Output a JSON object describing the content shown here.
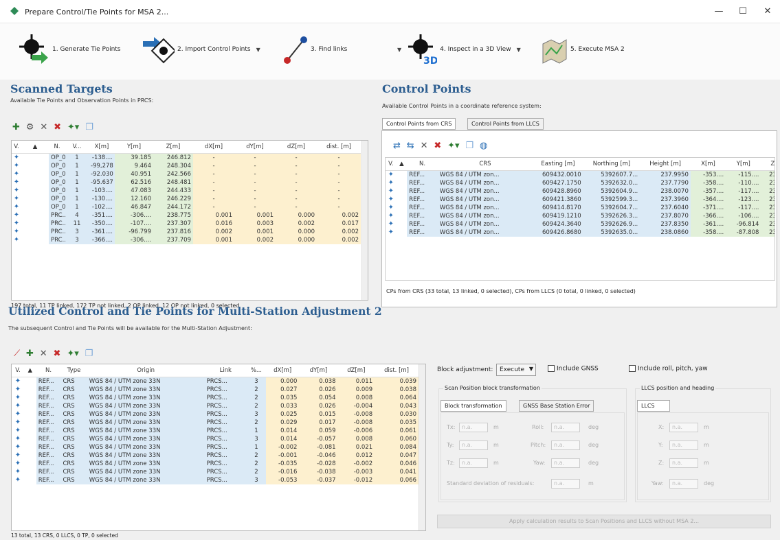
{
  "window": {
    "title": "Prepare Control/Tie Points for MSA 2..."
  },
  "toolbar": {
    "generate": "1. Generate Tie Points",
    "import": "2. Import Control Points",
    "find": "3. Find links",
    "inspect": "4. Inspect in a 3D View",
    "execute": "5. Execute MSA 2"
  },
  "scanned": {
    "title": "Scanned Targets",
    "subtitle": "Available Tie Points and Observation Points in PRCS:",
    "headers": [
      "V.",
      "▲",
      "N.",
      "V...",
      "X[m]",
      "Y[m]",
      "Z[m]",
      "dX[m]",
      "dY[m]",
      "dZ[m]",
      "dist. [m]"
    ],
    "rows": [
      [
        "",
        "OP_01",
        "1",
        "-138....",
        "39.185",
        "246.812",
        "-",
        "-",
        "-",
        "-"
      ],
      [
        "",
        "OP_02",
        "1",
        "-99,278",
        "9.464",
        "248.304",
        "-",
        "-",
        "-",
        "-"
      ],
      [
        "",
        "OP_03",
        "1",
        "-92.030",
        "40.951",
        "242.566",
        "-",
        "-",
        "-",
        "-"
      ],
      [
        "",
        "OP_04",
        "1",
        "-95.637",
        "62.516",
        "248.481",
        "-",
        "-",
        "-",
        "-"
      ],
      [
        "",
        "OP_05",
        "1",
        "-103....",
        "47.083",
        "244.433",
        "-",
        "-",
        "-",
        "-"
      ],
      [
        "",
        "OP_06",
        "1",
        "-130....",
        "12.160",
        "246.229",
        "-",
        "-",
        "-",
        "-"
      ],
      [
        "",
        "OP_07",
        "1",
        "-102....",
        "46.847",
        "244.172",
        "-",
        "-",
        "-",
        "-"
      ],
      [
        "",
        "PRC...",
        "4",
        "-351....",
        "-306....",
        "238.775",
        "0.001",
        "0.001",
        "0.000",
        "0.002"
      ],
      [
        "",
        "PRC...",
        "11",
        "-350....",
        "-107....",
        "237.307",
        "0.016",
        "0.003",
        "0.002",
        "0.017"
      ],
      [
        "",
        "PRC...",
        "3",
        "-361....",
        "-96.799",
        "237.816",
        "0.002",
        "0.001",
        "0.000",
        "0.002"
      ],
      [
        "",
        "PRC...",
        "3",
        "-366....",
        "-306....",
        "237.709",
        "0.001",
        "0.002",
        "0.000",
        "0.002"
      ]
    ],
    "status": "197 total, 11 TP linked, 172 TP not linked, 2 OP linked, 12 OP not linked, 0 selected"
  },
  "control": {
    "title": "Control Points",
    "subtitle": "Available Control Points in a coordinate reference system:",
    "tabs": [
      "Control Points from CRS",
      "Control Points from LLCS"
    ],
    "headers": [
      "V.",
      "▲",
      "N.",
      "CRS",
      "Easting [m]",
      "Northing [m]",
      "Height [m]",
      "X[m]",
      "Y[m]",
      "Z"
    ],
    "rows": [
      [
        "REF...",
        "WGS 84 / UTM zon...",
        "609432.0010",
        "5392607.7...",
        "237.9950",
        "-353....",
        "-115....",
        "237."
      ],
      [
        "REF...",
        "WGS 84 / UTM zon...",
        "609427.1750",
        "5392632.0...",
        "237.7790",
        "-358....",
        "-110....",
        "237."
      ],
      [
        "REF...",
        "WGS 84 / UTM zon...",
        "609428.8960",
        "5392604.9...",
        "238.0070",
        "-357....",
        "-117....",
        "237."
      ],
      [
        "REF...",
        "WGS 84 / UTM zon...",
        "609421.3860",
        "5392599.3...",
        "237.3960",
        "-364....",
        "-123....",
        "237."
      ],
      [
        "REF...",
        "WGS 84 / UTM zon...",
        "609414.8170",
        "5392604.7...",
        "237.6040",
        "-371....",
        "-117....",
        "237."
      ],
      [
        "REF...",
        "WGS 84 / UTM zon...",
        "609419.1210",
        "5392626.3...",
        "237.8070",
        "-366....",
        "-106....",
        "237."
      ],
      [
        "REF...",
        "WGS 84 / UTM zon...",
        "609424.3640",
        "5392626.9...",
        "237.8350",
        "-361....",
        "-96.814",
        "237."
      ],
      [
        "REF...",
        "WGS 84 / UTM zon...",
        "609426.8680",
        "5392635.0...",
        "238.0860",
        "-358....",
        "-87.808",
        "238."
      ]
    ],
    "status": "CPs from CRS (33 total, 13 linked, 0 selected), CPs from LLCS (0 total, 0 linked, 0 selected)"
  },
  "utilized": {
    "title": "Utilized Control and Tie Points for Multi-Station Adjustment 2",
    "subtitle": "The subsequent Control and Tie Points will be available for the Multi-Station Adjustment:",
    "headers": [
      "V.",
      "▲",
      "N.",
      "Type",
      "Origin",
      "Link",
      "%...",
      "dX[m]",
      "dY[m]",
      "dZ[m]",
      "dist. [m]"
    ],
    "rows": [
      [
        "REF...",
        "CRS",
        "WGS 84 / UTM zone 33N",
        "PRCS...",
        "3",
        "0.000",
        "0.038",
        "0.011",
        "0.039"
      ],
      [
        "REF...",
        "CRS",
        "WGS 84 / UTM zone 33N",
        "PRCS...",
        "2",
        "0.027",
        "0.026",
        "0.009",
        "0.038"
      ],
      [
        "REF...",
        "CRS",
        "WGS 84 / UTM zone 33N",
        "PRCS...",
        "2",
        "0.035",
        "0.054",
        "0.008",
        "0.064"
      ],
      [
        "REF...",
        "CRS",
        "WGS 84 / UTM zone 33N",
        "PRCS...",
        "2",
        "0.033",
        "0.026",
        "-0.004",
        "0.043"
      ],
      [
        "REF...",
        "CRS",
        "WGS 84 / UTM zone 33N",
        "PRCS...",
        "3",
        "0.025",
        "0.015",
        "-0.008",
        "0.030"
      ],
      [
        "REF...",
        "CRS",
        "WGS 84 / UTM zone 33N",
        "PRCS...",
        "2",
        "0.029",
        "0.017",
        "-0.008",
        "0.035"
      ],
      [
        "REF...",
        "CRS",
        "WGS 84 / UTM zone 33N",
        "PRCS...",
        "1",
        "0.014",
        "0.059",
        "-0.006",
        "0.061"
      ],
      [
        "REF...",
        "CRS",
        "WGS 84 / UTM zone 33N",
        "PRCS...",
        "3",
        "0.014",
        "-0.057",
        "0.008",
        "0.060"
      ],
      [
        "REF...",
        "CRS",
        "WGS 84 / UTM zone 33N",
        "PRCS...",
        "1",
        "-0.002",
        "-0.081",
        "0.021",
        "0.084"
      ],
      [
        "REF...",
        "CRS",
        "WGS 84 / UTM zone 33N",
        "PRCS...",
        "2",
        "-0.001",
        "-0.046",
        "0.012",
        "0.047"
      ],
      [
        "REF...",
        "CRS",
        "WGS 84 / UTM zone 33N",
        "PRCS...",
        "2",
        "-0.035",
        "-0.028",
        "-0.002",
        "0.046"
      ],
      [
        "REF...",
        "CRS",
        "WGS 84 / UTM zone 33N",
        "PRCS...",
        "2",
        "-0.016",
        "-0.038",
        "-0.003",
        "0.041"
      ],
      [
        "REF...",
        "CRS",
        "WGS 84 / UTM zone 33N",
        "PRCS...",
        "3",
        "-0.053",
        "-0.037",
        "-0.012",
        "0.066"
      ]
    ],
    "status": "13 total, 13 CRS, 0 LLCS, 0 TP, 0 selected"
  },
  "block": {
    "label": "Block adjustment:",
    "mode": "Execute",
    "include_gnss": "Include GNSS",
    "include_rpy": "Include roll, pitch, yaw",
    "scan_group": "Scan Position block transformation",
    "llcs_group": "LLCS position and heading",
    "tab1": "Block transformation",
    "tab2": "GNSS Base Station Error",
    "tab_llcs": "LLCS",
    "tx": "Tx:",
    "ty": "Ty:",
    "tz": "Tz:",
    "roll": "Roll:",
    "pitch": "Pitch:",
    "yaw": "Yaw:",
    "na": "n.a.",
    "m": "m",
    "deg": "deg",
    "x": "X:",
    "y": "Y:",
    "z": "Z:",
    "yaw2": "Yaw:",
    "std": "Standard deviation of residuals:",
    "apply": "Apply calculation results to Scan Positions and LLCS without MSA 2..."
  }
}
